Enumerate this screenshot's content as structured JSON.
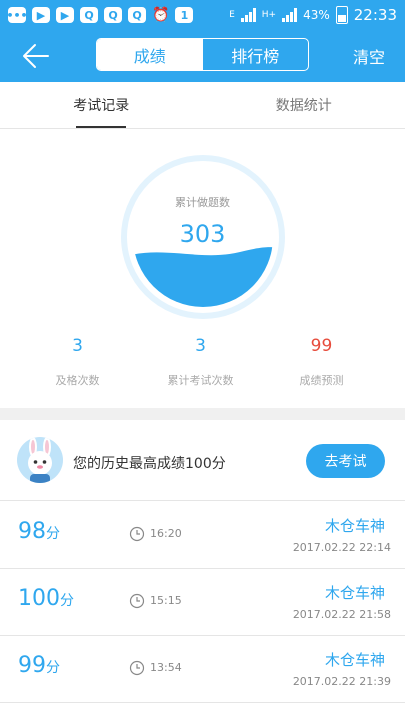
{
  "status_bar": {
    "time": "22:33",
    "battery": "43%",
    "notif_icons": [
      "chat-icon",
      "video-icon",
      "video-icon",
      "qq-icon",
      "qq-icon",
      "qq-icon",
      "alarm-icon",
      "calendar-icon"
    ],
    "calendar_day": "1",
    "network": "E",
    "network2": "H+"
  },
  "header": {
    "tabs": [
      {
        "label": "成绩"
      },
      {
        "label": "排行榜"
      }
    ],
    "clear_label": "清空"
  },
  "tabs": [
    {
      "label": "考试记录"
    },
    {
      "label": "数据统计"
    }
  ],
  "gauge": {
    "label": "累计做题数",
    "value": "303",
    "fill_level": 0.35
  },
  "stats": [
    {
      "value": "3",
      "label": "及格次数"
    },
    {
      "value": "3",
      "label": "累计考试次数"
    },
    {
      "value": "99",
      "label": "成绩预测"
    }
  ],
  "best": {
    "text": "您的历史最高成绩100分",
    "button_label": "去考试"
  },
  "records": [
    {
      "score": "98",
      "unit": "分",
      "time": "16:20",
      "user": "木仓车神",
      "date": "2017.02.22  22:14"
    },
    {
      "score": "100",
      "unit": "分",
      "time": "15:15",
      "user": "木仓车神",
      "date": "2017.02.22  21:58"
    },
    {
      "score": "99",
      "unit": "分",
      "time": "13:54",
      "user": "木仓车神",
      "date": "2017.02.22  21:39"
    }
  ],
  "colors": {
    "accent": "#2fa7ee",
    "predict": "#e74c3c"
  }
}
